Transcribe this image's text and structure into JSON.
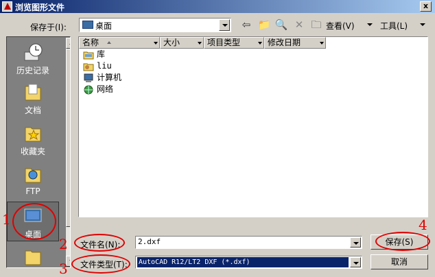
{
  "window": {
    "title": "浏览图形文件",
    "close_glyph": "x"
  },
  "toolbar": {
    "save_in_label": "保存于(I):",
    "location_value": "桌面",
    "views_label": "查看(V)",
    "tools_label": "工具(L)"
  },
  "places": [
    {
      "label": "历史记录",
      "icon": "history-icon"
    },
    {
      "label": "文档",
      "icon": "documents-folder-icon"
    },
    {
      "label": "收藏夹",
      "icon": "favorites-folder-icon"
    },
    {
      "label": "FTP",
      "icon": "ftp-icon"
    },
    {
      "label": "桌面",
      "icon": "desktop-icon"
    }
  ],
  "columns": [
    "名称",
    "大小",
    "项目类型",
    "修改日期"
  ],
  "files": [
    {
      "name": "库",
      "icon": "library-icon"
    },
    {
      "name": "liu",
      "icon": "user-folder-icon"
    },
    {
      "name": "计算机",
      "icon": "computer-icon"
    },
    {
      "name": "网络",
      "icon": "network-icon"
    }
  ],
  "form": {
    "filename_label": "文件名(N):",
    "filename_value": "2.dxf",
    "filetype_label": "文件类型(T):",
    "filetype_value": "AutoCAD R12/LT2 DXF (*.dxf)",
    "save_button": "保存(S)",
    "cancel_button": "取消"
  },
  "annotations": [
    "1",
    "2",
    "3",
    "4"
  ],
  "colors": {
    "annotation": "#e00000",
    "titlebar": "#0a246a",
    "selection": "#0a246a"
  }
}
